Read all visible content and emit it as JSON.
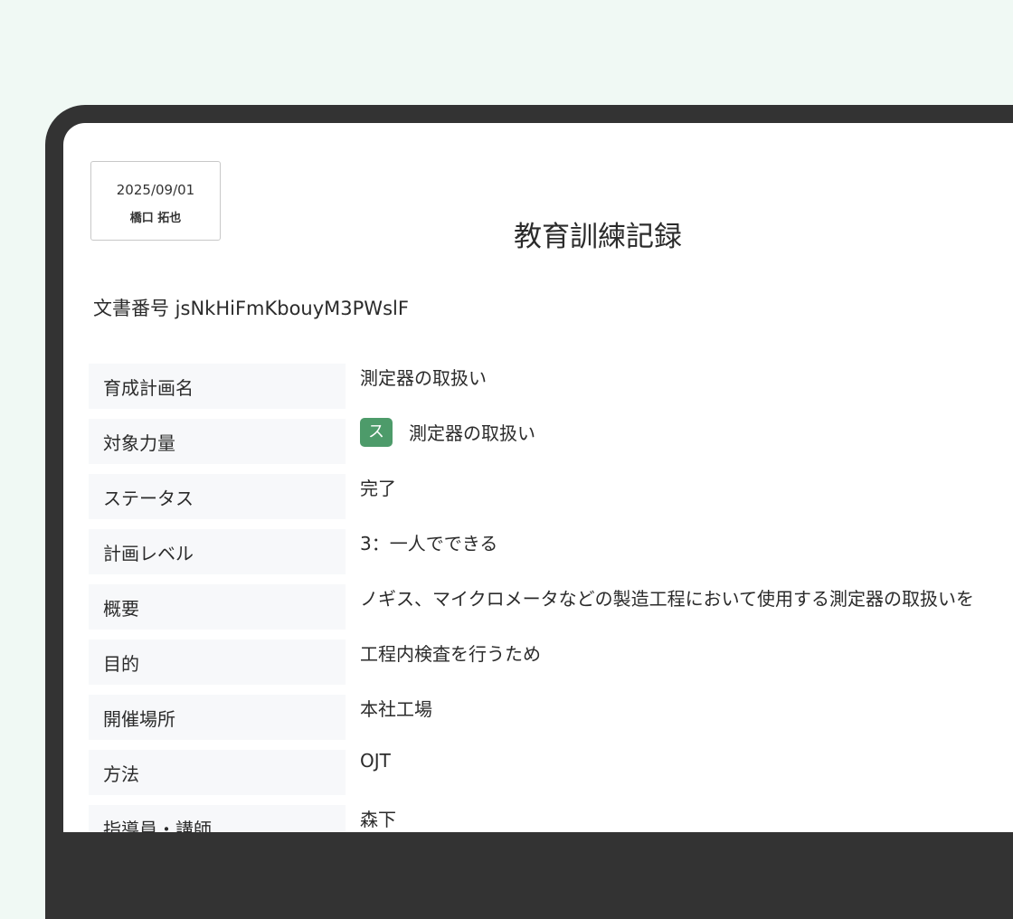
{
  "stamp": {
    "date": "2025/09/01",
    "name": "橋口 拓也"
  },
  "document": {
    "title": "教育訓練記録",
    "number_label": "文書番号 jsNkHiFmKbouyM3PWslF"
  },
  "fields": [
    {
      "label": "育成計画名",
      "value": "測定器の取扱い"
    },
    {
      "label": "対象力量",
      "badge": "ス",
      "value": "測定器の取扱い"
    },
    {
      "label": "ステータス",
      "value": "完了"
    },
    {
      "label": "計画レベル",
      "value": "3：一人でできる"
    },
    {
      "label": "概要",
      "value": "ノギス、マイクロメータなどの製造工程において使用する測定器の取扱いを"
    },
    {
      "label": "目的",
      "value": "工程内検査を行うため"
    },
    {
      "label": "開催場所",
      "value": "本社工場"
    },
    {
      "label": "方法",
      "value": "OJT"
    },
    {
      "label": "指導員・講師",
      "value": "森下"
    }
  ],
  "colors": {
    "background": "#f0f9f4",
    "device_frame": "#333333",
    "label_bg": "#f7f8fa",
    "badge_bg": "#4d9b6a"
  }
}
